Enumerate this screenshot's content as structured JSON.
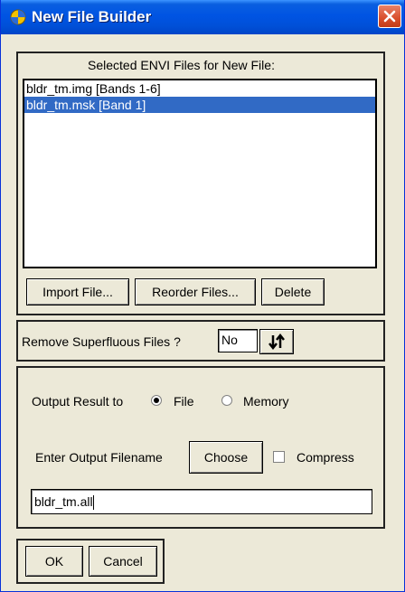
{
  "window": {
    "title": "New File Builder"
  },
  "files_panel": {
    "heading": "Selected ENVI Files for New File:",
    "items": [
      {
        "label": "bldr_tm.img [Bands 1-6]",
        "selected": false
      },
      {
        "label": "bldr_tm.msk [Band 1]",
        "selected": true
      }
    ],
    "buttons": {
      "import": "Import File...",
      "reorder": "Reorder Files...",
      "delete": "Delete"
    }
  },
  "remove_superfluous": {
    "label": "Remove Superfluous Files ?",
    "value": "No"
  },
  "output": {
    "result_label": "Output Result to",
    "option_file": "File",
    "option_memory": "Memory",
    "selected": "File",
    "filename_label": "Enter Output Filename",
    "choose_label": "Choose",
    "compress_label": "Compress",
    "compress_checked": false,
    "filename_value": "bldr_tm.all"
  },
  "footer": {
    "ok": "OK",
    "cancel": "Cancel"
  },
  "colors": {
    "titlebar": "#0054e3",
    "selection": "#316ac5",
    "close": "#d94e2b",
    "dialog_bg": "#ece9d8"
  }
}
